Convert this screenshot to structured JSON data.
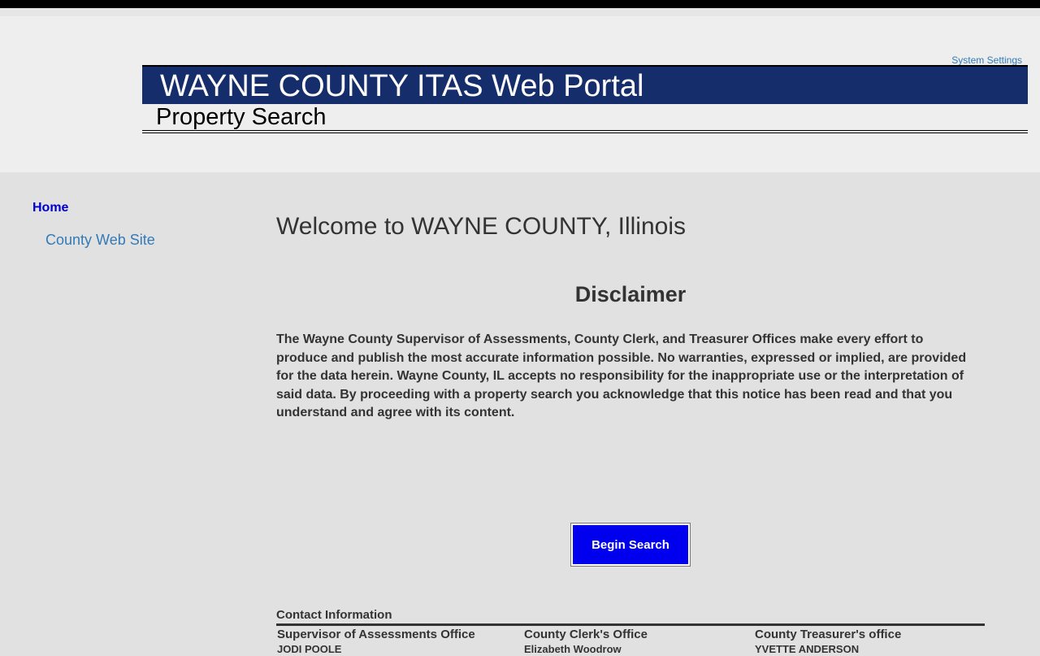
{
  "header": {
    "settings_label": "System Settings",
    "title": "WAYNE COUNTY ITAS Web Portal",
    "subtitle": "Property Search"
  },
  "sidebar": {
    "items": [
      {
        "label": "Home"
      },
      {
        "label": "County Web Site"
      }
    ]
  },
  "main": {
    "welcome": "Welcome to WAYNE COUNTY, Illinois",
    "disclaimer_title": "Disclaimer",
    "disclaimer_text": "The Wayne County Supervisor of Assessments, County Clerk, and Treasurer Offices make every effort to produce and publish the most accurate information possible.  No warranties, expressed or implied, are provided for the data herein.  Wayne County, IL accepts no responsibility for the inappropriate use or the interpretation of said data.  By proceeding with a property search you acknowledge that this notice has been read and that you understand and agree with its content.",
    "begin_search_label": "Begin Search"
  },
  "contact": {
    "heading": "Contact Information",
    "offices": [
      {
        "title": "Supervisor of Assessments Office",
        "name": "JODI POOLE"
      },
      {
        "title": "County Clerk's Office",
        "name": "Elizabeth Woodrow"
      },
      {
        "title": "County Treasurer's office",
        "name": "YVETTE ANDERSON"
      }
    ]
  },
  "colors": {
    "title_bar": "#162d6b",
    "button": "#0000ee",
    "link": "#337ab7",
    "home_link": "#0000cc"
  }
}
